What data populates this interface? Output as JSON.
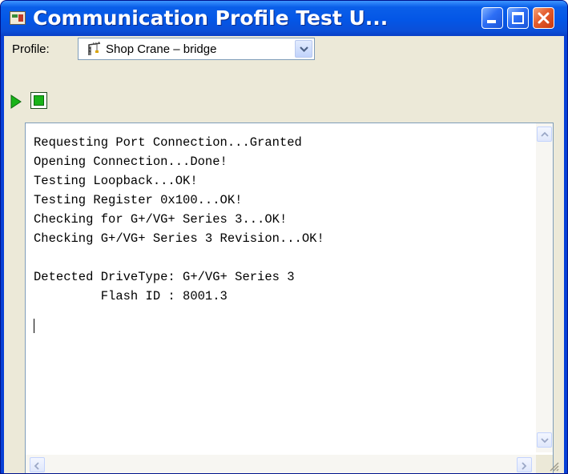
{
  "window": {
    "title": "Communication Profile Test U...",
    "icon": "app-icon"
  },
  "toolbar": {
    "profile_label": "Profile:",
    "profile_value": "Shop Crane – bridge",
    "profile_icon": "crane-icon",
    "run_icon": "play-icon",
    "stop_icon": "stop-icon"
  },
  "log": {
    "lines": [
      "Requesting Port Connection...Granted",
      "Opening Connection...Done!",
      "Testing Loopback...OK!",
      "Testing Register 0x100...OK!",
      "Checking for G+/VG+ Series 3...OK!",
      "Checking G+/VG+ Series 3 Revision...OK!",
      "",
      "Detected DriveType: G+/VG+ Series 3",
      "         Flash ID : 8001.3"
    ]
  },
  "colors": {
    "titlebar": "#0a5fe9",
    "client_bg": "#ece9d8",
    "run_green": "#19b319"
  }
}
